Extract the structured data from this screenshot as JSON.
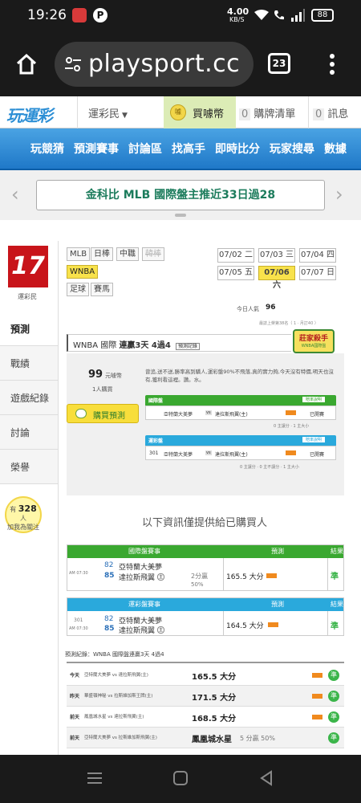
{
  "status_bar": {
    "time": "19:26",
    "speed_value": "4.00",
    "speed_unit": "KB/S",
    "battery": "88"
  },
  "browser": {
    "url": "playsport.cc",
    "tab_count": "23"
  },
  "site_nav": {
    "logo_text": "玩運彩",
    "user_menu": "運彩民",
    "buy_coins": "買噱幣",
    "cart_count": "0",
    "cart_label": "購牌清單",
    "msg_count": "0",
    "msg_label": "訊息"
  },
  "main_nav": [
    "玩競猜",
    "預測賽事",
    "討論區",
    "找高手",
    "即時比分",
    "玩家搜尋",
    "數據"
  ],
  "promo": {
    "text": "金科比 MLB 國際盤主推近33日過28"
  },
  "profile": {
    "logo_text": "17",
    "name": "運彩民"
  },
  "sidebar": {
    "items": [
      "預測",
      "戰績",
      "遊戲紀錄",
      "討論",
      "榮譽"
    ],
    "visitor_count": "328",
    "visitor_prefix": "有",
    "visitor_suffix": "人",
    "visitor_note": "加我為關注"
  },
  "sports_tags": [
    "MLB",
    "日棒",
    "中職",
    "韓棒",
    "WNBA",
    "足球",
    "賽馬"
  ],
  "dates": [
    [
      "07/02 二",
      "07/03 三",
      "07/04 四"
    ],
    [
      "07/05 五",
      "07/06 六",
      "07/07 日"
    ]
  ],
  "popularity": {
    "label": "今日人氣",
    "value": "96"
  },
  "ranking_text": "最誌上榮第38名（ 1 · 月訂40 ）",
  "badge_text": "莊家殺手",
  "badge_sub": "WNBA國際盤",
  "section_title": {
    "league": "WNBA 國際",
    "streak": "連贏3天 4過4",
    "record_link": "預測記錄"
  },
  "price": {
    "amount": "99",
    "unit": "元噱幣",
    "buyers": "1人購買",
    "buy_button": "購買預測"
  },
  "description": "曾追,送不送,勝率高到驕人,運彩盤90%不飛落,真的實力夠,今天沒有特價,明天也沒有,獲利看這裡。讚。水。",
  "intl_pick": {
    "header": "國際盤",
    "btn": "賠率說明",
    "team1": "亞特蘭大美夢",
    "vs": "vs",
    "team2": "達拉斯飛翼(主)",
    "status": "已開賽",
    "note": "0 主讓分 · 1 主大小"
  },
  "lottery_pick": {
    "header": "運彩盤",
    "btn": "賠率說明",
    "num": "301",
    "team1": "亞特蘭大美夢",
    "vs": "vs",
    "team2": "達拉斯飛翼(主)",
    "status": "已開賽",
    "note": "0 主讓分 · 0 主不讓分 · 1 主大小"
  },
  "buyers_only": "以下資訊僅提供給已購買人",
  "intl_result": {
    "cols": [
      "國際盤賽事",
      "預測",
      "結果"
    ],
    "time": "AM 07:30",
    "n1": "82",
    "n2": "85",
    "team1": "亞特蘭大美夢",
    "team2": "達拉斯飛翼",
    "home_mark": "主",
    "spread": "2分贏",
    "pct": "50%",
    "pick": "165.5 大分",
    "result": "準"
  },
  "lottery_result": {
    "cols": [
      "運彩盤賽事",
      "預測",
      "結果"
    ],
    "num": "301",
    "time": "AM 07:30",
    "n1": "82",
    "n2": "85",
    "team1": "亞特蘭大美夢",
    "team2": "達拉斯飛翼",
    "home_mark": "主",
    "pick": "164.5 大分",
    "result": "準"
  },
  "history": {
    "title": "預測紀錄：WNBA 國際盤連贏3天 4過4",
    "rows": [
      {
        "day": "今天",
        "teams": "亞特蘭大美夢 vs 達拉斯飛翼(主)",
        "pick": "165.5 大分",
        "extra": "",
        "result": "準"
      },
      {
        "day": "昨天",
        "teams": "華盛頓神秘 vs 拉斯維加斯王牌(主)",
        "pick": "171.5 大分",
        "extra": "",
        "result": "準"
      },
      {
        "day": "前天",
        "teams": "鳳凰城水星 vs 達拉斯飛翼(主)",
        "pick": "168.5 大分",
        "extra": "",
        "result": "準"
      },
      {
        "day": "前天",
        "teams": "亞特蘭大美夢 vs 拉斯維加斯飛翼(主)",
        "pick": "鳳凰城水星",
        "extra": "5 分贏 50%",
        "result": "準"
      }
    ]
  }
}
